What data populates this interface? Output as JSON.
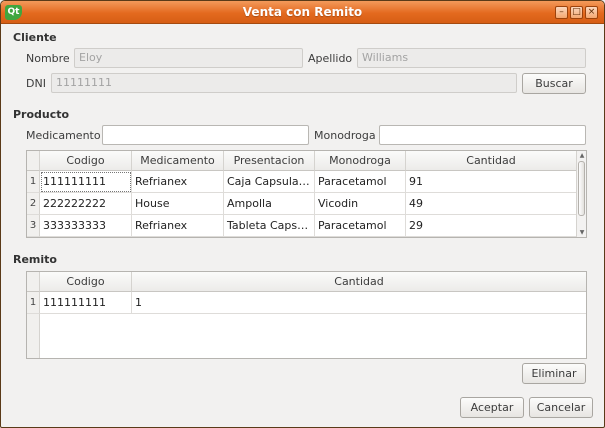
{
  "window": {
    "title": "Venta con Remito",
    "logo_text": "Qt"
  },
  "cliente": {
    "section_label": "Cliente",
    "nombre_label": "Nombre",
    "nombre_value": "Eloy",
    "apellido_label": "Apellido",
    "apellido_value": "Williams",
    "dni_label": "DNI",
    "dni_value": "11111111",
    "buscar_label": "Buscar"
  },
  "producto": {
    "section_label": "Producto",
    "medicamento_label": "Medicamento",
    "medicamento_value": "",
    "monodroga_label": "Monodroga",
    "monodroga_value": "",
    "table": {
      "headers": [
        "Codigo",
        "Medicamento",
        "Presentacion",
        "Monodroga",
        "Cantidad"
      ],
      "rows": [
        {
          "num": "1",
          "codigo": "111111111",
          "medicamento": "Refrianex",
          "presentacion": "Caja Capsulas ...",
          "monodroga": "Paracetamol",
          "cantidad": "91"
        },
        {
          "num": "2",
          "codigo": "222222222",
          "medicamento": "House",
          "presentacion": "Ampolla",
          "monodroga": "Vicodin",
          "cantidad": "49"
        },
        {
          "num": "3",
          "codigo": "333333333",
          "medicamento": "Refrianex",
          "presentacion": "Tableta Capsul...",
          "monodroga": "Paracetamol",
          "cantidad": "29"
        }
      ]
    }
  },
  "remito": {
    "section_label": "Remito",
    "table": {
      "headers": [
        "Codigo",
        "Cantidad"
      ],
      "rows": [
        {
          "num": "1",
          "codigo": "111111111",
          "cantidad": "1"
        }
      ]
    },
    "eliminar_label": "Eliminar"
  },
  "actions": {
    "aceptar_label": "Aceptar",
    "cancelar_label": "Cancelar"
  },
  "colors": {
    "titlebar": "#e46a1f",
    "window_bg": "#f2f1f0"
  }
}
